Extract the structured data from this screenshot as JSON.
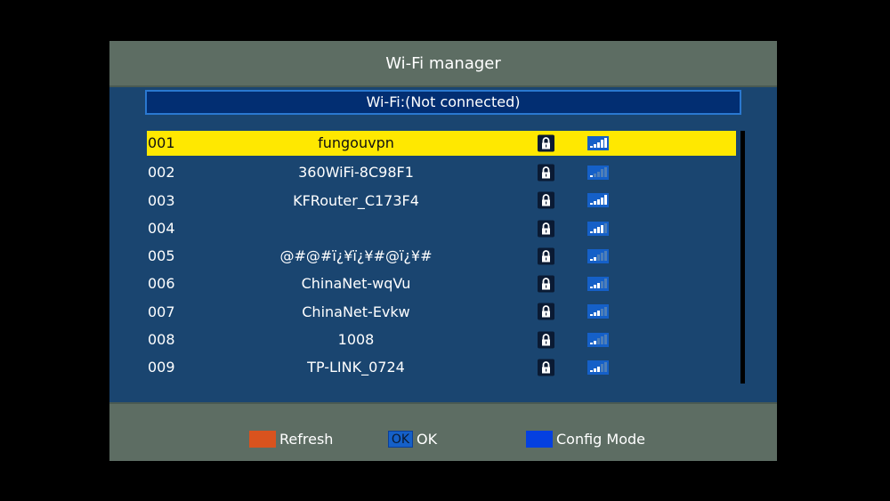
{
  "title": "Wi-Fi manager",
  "status": "Wi-Fi:(Not connected)",
  "networks": [
    {
      "num": "001",
      "name": "fungouvpn",
      "locked": true,
      "signal": 5,
      "selected": true
    },
    {
      "num": "002",
      "name": "360WiFi-8C98F1",
      "locked": true,
      "signal": 1
    },
    {
      "num": "003",
      "name": "KFRouter_C173F4",
      "locked": true,
      "signal": 5
    },
    {
      "num": "004",
      "name": "",
      "locked": true,
      "signal": 4
    },
    {
      "num": "005",
      "name": "@#@#ï¿¥ï¿¥#@ï¿¥#",
      "locked": true,
      "signal": 2
    },
    {
      "num": "006",
      "name": "ChinaNet-wqVu",
      "locked": true,
      "signal": 3
    },
    {
      "num": "007",
      "name": "ChinaNet-Evkw",
      "locked": true,
      "signal": 3
    },
    {
      "num": "008",
      "name": "1008",
      "locked": true,
      "signal": 2
    },
    {
      "num": "009",
      "name": "TP-LINK_0724",
      "locked": true,
      "signal": 3
    }
  ],
  "footer": {
    "refresh_label": "Refresh",
    "refresh_color": "#d9531e",
    "ok_key": "OK",
    "ok_label": "OK",
    "config_label": "Config Mode",
    "config_color": "#0540e0"
  },
  "colors": {
    "selected_row": "#ffe800",
    "panel": "#1a4570",
    "chrome": "#5d6d63"
  }
}
